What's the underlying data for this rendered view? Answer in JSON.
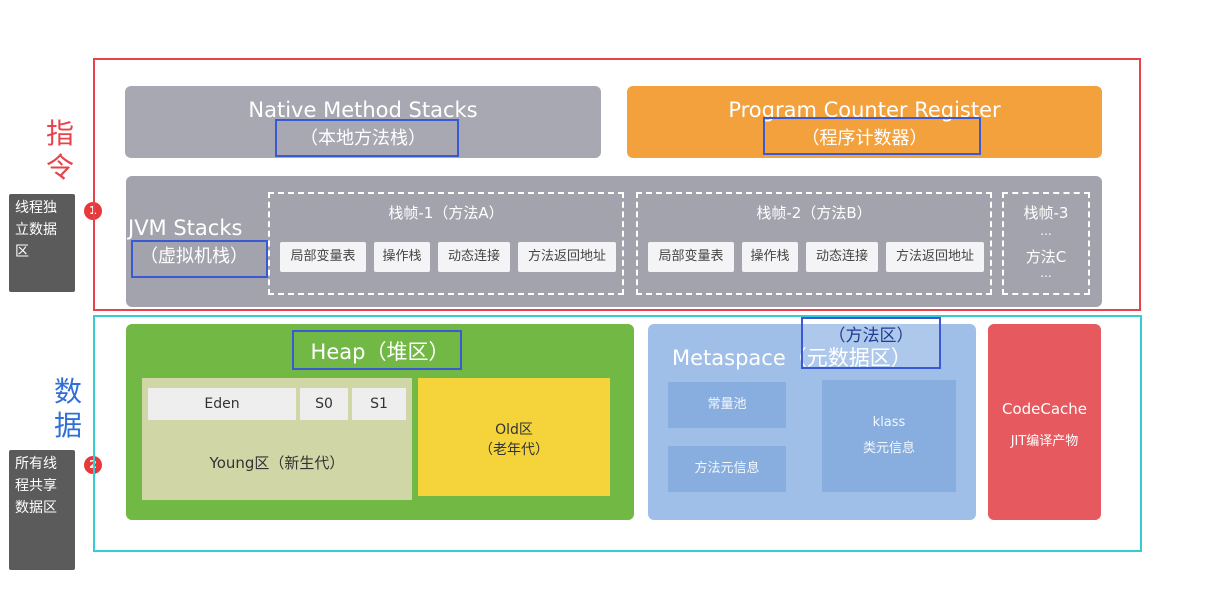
{
  "side": {
    "instruction_title": "指令",
    "data_title": "数据",
    "tag1": "线程独立数据区",
    "tag2": "所有线程共享数据区",
    "badge1": "1",
    "badge2": "2"
  },
  "native": {
    "title": "Native Method Stacks",
    "subtitle": "（本地方法栈）"
  },
  "pcr": {
    "title": "Program Counter Register",
    "subtitle": "（程序计数器）"
  },
  "jvm": {
    "title": "JVM Stacks",
    "subtitle": "（虚拟机栈）",
    "frames": [
      {
        "title": "栈帧-1（方法A）",
        "cells": [
          "局部变量表",
          "操作栈",
          "动态连接",
          "方法返回地址"
        ]
      },
      {
        "title": "栈帧-2（方法B）",
        "cells": [
          "局部变量表",
          "操作栈",
          "动态连接",
          "方法返回地址"
        ]
      }
    ],
    "frame3": {
      "title": "栈帧-3",
      "dots1": "...",
      "method": "方法C",
      "dots2": "..."
    }
  },
  "heap": {
    "title": "Heap（堆区）",
    "eden": "Eden",
    "s0": "S0",
    "s1": "S1",
    "young": "Young区（新生代）",
    "old_line1": "Old区",
    "old_line2": "（老年代）"
  },
  "meta": {
    "title": "Metaspace（元数据区）",
    "annotation": "（方法区）",
    "const_pool": "常量池",
    "method_meta": "方法元信息",
    "klass": "klass",
    "klass_sub": "类元信息"
  },
  "codecache": {
    "title": "CodeCache",
    "subtitle": "JIT编译产物"
  },
  "colors": {
    "instruction_frame": "#e8434a",
    "data_frame": "#35cdd3",
    "native": "#a8a8b2",
    "pcr": "#f2a13c",
    "heap": "#72b845",
    "old": "#f4d43a",
    "metaspace": "#9fbfe8",
    "codecache": "#e5595f",
    "annotation": "#3a59d4"
  }
}
